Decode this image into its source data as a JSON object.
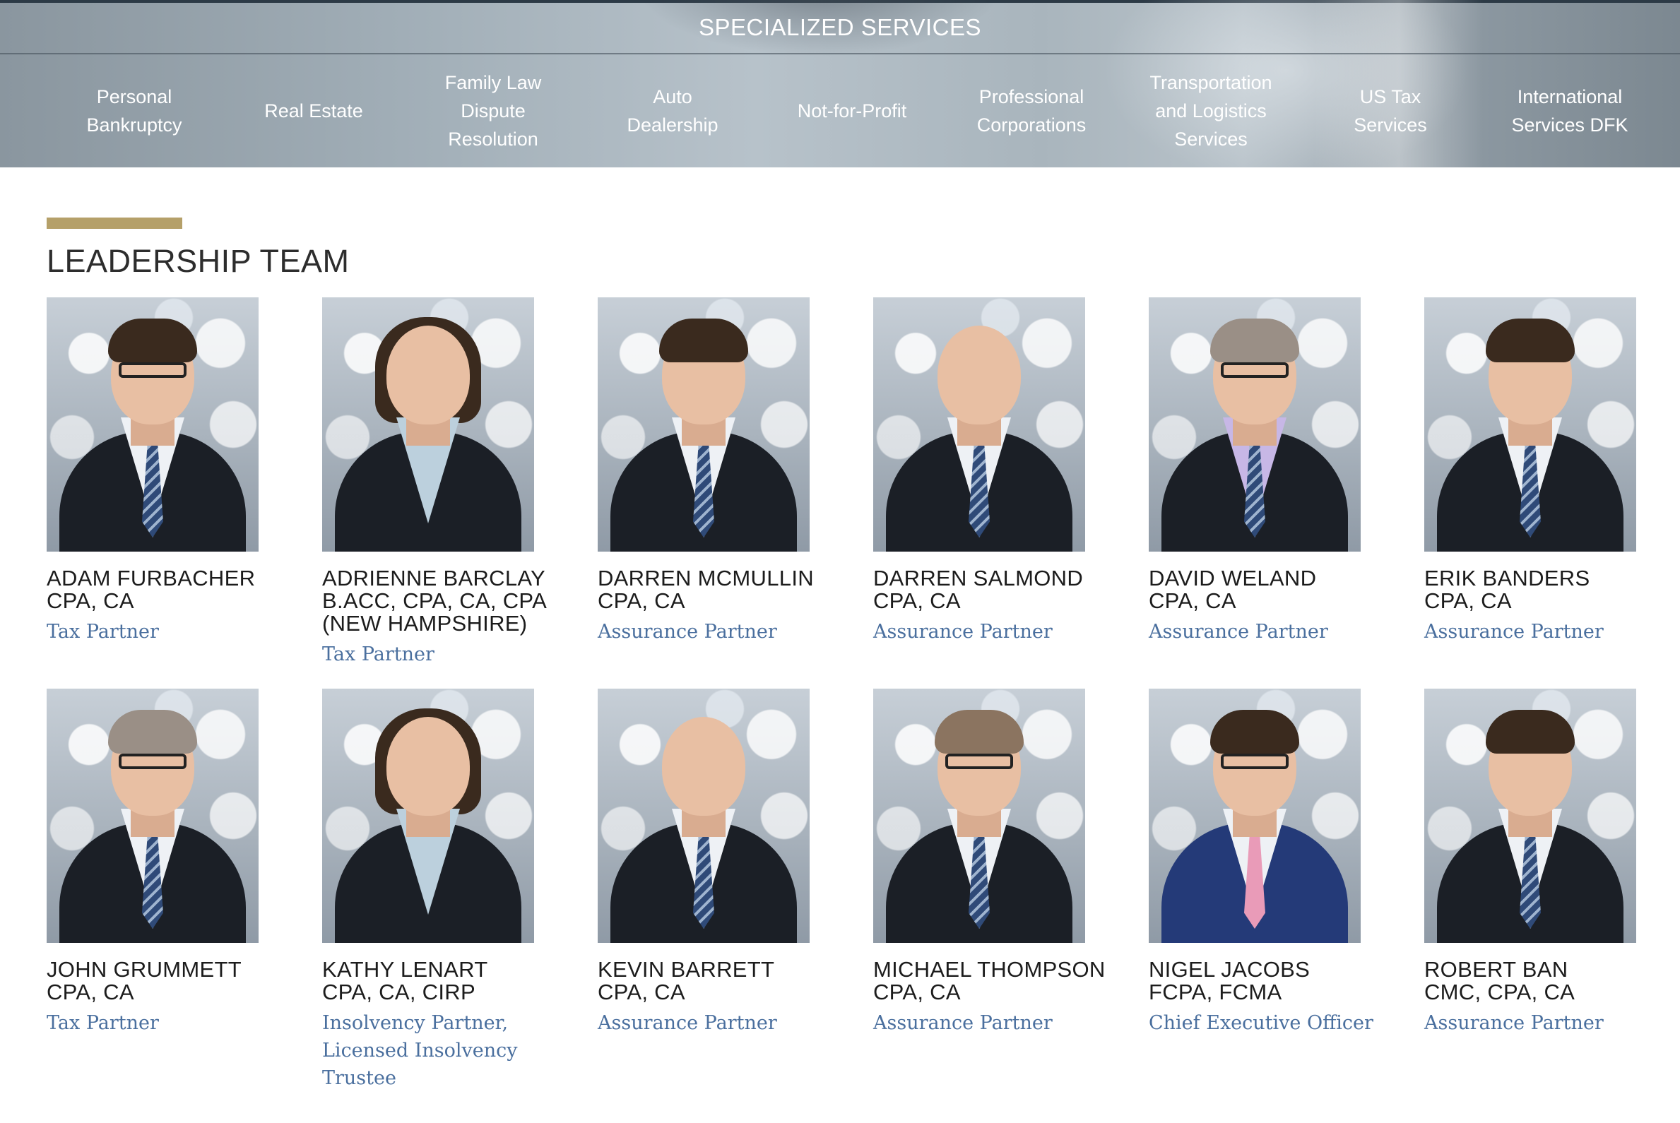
{
  "services": {
    "title": "SPECIALIZED SERVICES",
    "items": [
      "Personal\nBankruptcy",
      "Real Estate",
      "Family Law\nDispute\nResolution",
      "Auto\nDealership",
      "Not-for-Profit",
      "Professional\nCorporations",
      "Transportation\nand Logistics\nServices",
      "US Tax\nServices",
      "International\nServices DFK"
    ]
  },
  "leadership": {
    "title": "LEADERSHIP TEAM",
    "members": [
      {
        "name": "ADAM FURBACHER",
        "credentials": "CPA, CA",
        "role": "Tax Partner"
      },
      {
        "name": "ADRIENNE BARCLAY",
        "credentials": "B.ACC, CPA, CA, CPA\n(NEW HAMPSHIRE)",
        "role": "Tax Partner"
      },
      {
        "name": "DARREN MCMULLIN",
        "credentials": "CPA, CA",
        "role": "Assurance Partner"
      },
      {
        "name": "DARREN SALMOND",
        "credentials": "CPA, CA",
        "role": "Assurance Partner"
      },
      {
        "name": "DAVID WELAND",
        "credentials": "CPA, CA",
        "role": "Assurance Partner"
      },
      {
        "name": "ERIK BANDERS",
        "credentials": "CPA, CA",
        "role": "Assurance Partner"
      },
      {
        "name": "JOHN GRUMMETT",
        "credentials": "CPA, CA",
        "role": "Tax Partner"
      },
      {
        "name": "KATHY LENART",
        "credentials": "CPA, CA, CIRP",
        "role": "Insolvency Partner,\nLicensed Insolvency\nTrustee"
      },
      {
        "name": "KEVIN BARRETT",
        "credentials": "CPA, CA",
        "role": "Assurance Partner"
      },
      {
        "name": "MICHAEL THOMPSON",
        "credentials": "CPA, CA",
        "role": "Assurance Partner"
      },
      {
        "name": "NIGEL JACOBS",
        "credentials": "FCPA, FCMA",
        "role": "Chief Executive Officer"
      },
      {
        "name": "ROBERT BAN",
        "credentials": "CMC, CPA, CA",
        "role": "Assurance Partner"
      }
    ]
  },
  "colors": {
    "accent_gold": "#b5a069",
    "role_blue": "#4a6f9e",
    "heading_dark": "#2d2d2d"
  }
}
